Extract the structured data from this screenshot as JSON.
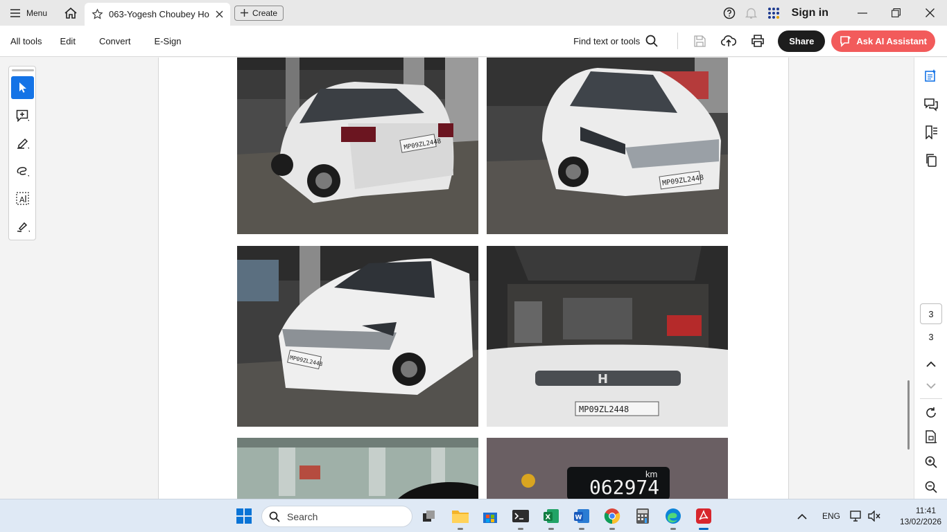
{
  "titlebar": {
    "menu_label": "Menu",
    "tab_title": "063-Yogesh Choubey Ho...",
    "create_label": "Create",
    "signin_label": "Sign in"
  },
  "toolbar": {
    "items": [
      "All tools",
      "Edit",
      "Convert",
      "E-Sign"
    ],
    "find_label": "Find text or tools",
    "share_label": "Share",
    "ai_label": "Ask AI Assistant"
  },
  "document": {
    "photos": [
      {
        "desc": "rear-left view of white Honda Amaze",
        "plate": "MP09ZL2448"
      },
      {
        "desc": "front-right view of white Honda Amaze",
        "plate": "MP09ZL2448"
      },
      {
        "desc": "front-left view of white Honda Amaze",
        "plate": "MP09ZL2448"
      },
      {
        "desc": "open bonnet engine bay",
        "plate": "MP09ZL2448"
      },
      {
        "desc": "interior windshield view of parking",
        "plate": ""
      },
      {
        "desc": "odometer reading",
        "plate": ""
      }
    ],
    "odometer_value": "062974",
    "odometer_unit": "km"
  },
  "page_nav": {
    "current_page": "3",
    "total_pages": "3"
  },
  "taskbar": {
    "search_placeholder": "Search",
    "language": "ENG",
    "time": "11:41",
    "date": "13/02/2026"
  },
  "colors": {
    "accent_blue": "#1473e6",
    "ai_red": "#f25b5b",
    "share_dark": "#1d1d1d"
  }
}
